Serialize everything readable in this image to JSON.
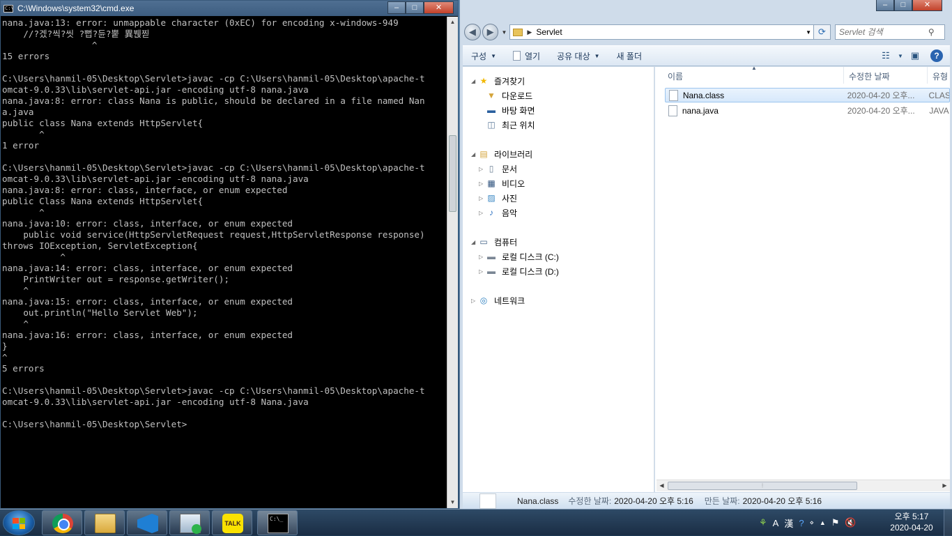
{
  "cmd": {
    "title": "C:\\Windows\\system32\\cmd.exe",
    "lines": [
      "        ^",
      "nana.java:13: error: unmappable character (0xEC) for encoding x-windows-949",
      "    //?겠?씩?씻 ?뻡?듄?뿥 異붽찓",
      "                 ^",
      "15 errors",
      "",
      "C:\\Users\\hanmil-05\\Desktop\\Servlet>javac -cp C:\\Users\\hanmil-05\\Desktop\\apache-t",
      "omcat-9.0.33\\lib\\servlet-api.jar -encoding utf-8 nana.java",
      "nana.java:8: error: class Nana is public, should be declared in a file named Nan",
      "a.java",
      "public class Nana extends HttpServlet{",
      "       ^",
      "1 error",
      "",
      "C:\\Users\\hanmil-05\\Desktop\\Servlet>javac -cp C:\\Users\\hanmil-05\\Desktop\\apache-t",
      "omcat-9.0.33\\lib\\servlet-api.jar -encoding utf-8 nana.java",
      "nana.java:8: error: class, interface, or enum expected",
      "public Class Nana extends HttpServlet{",
      "       ^",
      "nana.java:10: error: class, interface, or enum expected",
      "    public void service(HttpServletRequest request,HttpServletResponse response)",
      "throws IOException, ServletException{",
      "           ^",
      "nana.java:14: error: class, interface, or enum expected",
      "    PrintWriter out = response.getWriter();",
      "    ^",
      "nana.java:15: error: class, interface, or enum expected",
      "    out.println(\"Hello Servlet Web\");",
      "    ^",
      "nana.java:16: error: class, interface, or enum expected",
      "}",
      "^",
      "5 errors",
      "",
      "C:\\Users\\hanmil-05\\Desktop\\Servlet>javac -cp C:\\Users\\hanmil-05\\Desktop\\apache-t",
      "omcat-9.0.33\\lib\\servlet-api.jar -encoding utf-8 Nana.java",
      "",
      "C:\\Users\\hanmil-05\\Desktop\\Servlet>"
    ]
  },
  "explorer": {
    "address": "Servlet",
    "search_placeholder": "Servlet 검색",
    "toolbar": {
      "organize": "구성",
      "open": "열기",
      "share": "공유 대상",
      "new_folder": "새 폴더"
    },
    "nav": {
      "favorites": "즐겨찾기",
      "downloads": "다운로드",
      "desktop": "바탕 화면",
      "recent": "최근 위치",
      "libraries": "라이브러리",
      "documents": "문서",
      "videos": "비디오",
      "pictures": "사진",
      "music": "음악",
      "computer": "컴퓨터",
      "drive_c": "로컬 디스크 (C:)",
      "drive_d": "로컬 디스크 (D:)",
      "network": "네트워크"
    },
    "columns": {
      "name": "이름",
      "modified": "수정한 날짜",
      "type": "유형"
    },
    "files": [
      {
        "name": "Nana.class",
        "modified": "2020-04-20 오후...",
        "type": "CLASS"
      },
      {
        "name": "nana.java",
        "modified": "2020-04-20 오후...",
        "type": "JAVA"
      }
    ],
    "details": {
      "filename": "Nana.class",
      "modified_label": "수정한 날짜:",
      "modified_value": "2020-04-20 오후 5:16",
      "created_label": "만든 날짜:",
      "created_value": "2020-04-20 오후 5:16"
    }
  },
  "taskbar": {
    "talk_label": "TALK",
    "ime_a": "A",
    "ime_han": "漢",
    "time": "오후 5:17",
    "date": "2020-04-20"
  }
}
